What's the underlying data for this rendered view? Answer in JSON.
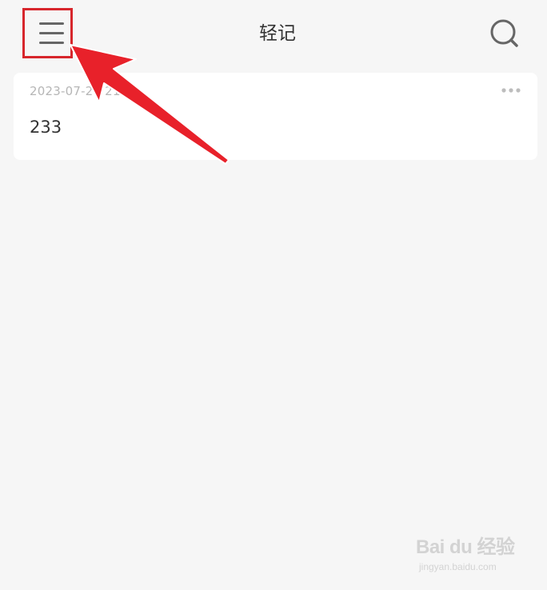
{
  "header": {
    "title": "轻记",
    "menu_icon": "hamburger-menu-icon",
    "search_icon": "search-icon"
  },
  "notes": [
    {
      "date": "2023-07-29 21",
      "content": "233",
      "more_icon": "more-dots-icon"
    }
  ],
  "annotation": {
    "highlight_color": "#d7262c",
    "arrow_color": "#e8212a"
  },
  "watermark": {
    "logo_text": "Bai du 经验",
    "url": "jingyan.baidu.com"
  },
  "colors": {
    "background": "#f6f6f6",
    "card": "#ffffff",
    "text_primary": "#333333",
    "text_secondary": "#b6b6b6",
    "icon": "#666666"
  }
}
